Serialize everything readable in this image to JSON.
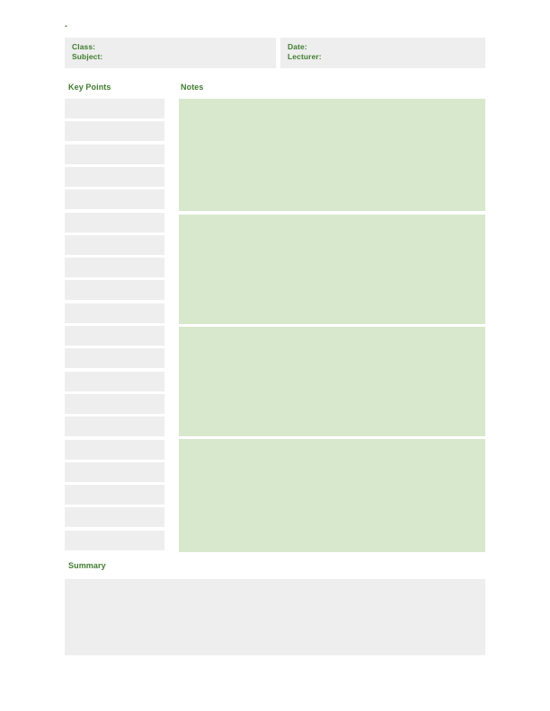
{
  "page": {
    "stray_mark": ".",
    "background_color": "#ffffff"
  },
  "colors": {
    "heading_green": "#3f7c2f",
    "field_fill_grey": "#eeeeee",
    "notes_fill_green": "#d8e8cc"
  },
  "header": {
    "left_cell": {
      "class_label": "Class:",
      "subject_label": "Subject:"
    },
    "right_cell": {
      "date_label": "Date:",
      "lecturer_label": "Lecturer:"
    }
  },
  "captions": {
    "key_points": "Key Points",
    "notes": "Notes",
    "summary": "Summary"
  },
  "key_points": {
    "row_count": 20,
    "rows": [
      {
        "value": ""
      },
      {
        "value": ""
      },
      {
        "value": ""
      },
      {
        "value": ""
      },
      {
        "value": ""
      },
      {
        "value": ""
      },
      {
        "value": ""
      },
      {
        "value": ""
      },
      {
        "value": ""
      },
      {
        "value": ""
      },
      {
        "value": ""
      },
      {
        "value": ""
      },
      {
        "value": ""
      },
      {
        "value": ""
      },
      {
        "value": ""
      },
      {
        "value": ""
      },
      {
        "value": ""
      },
      {
        "value": ""
      },
      {
        "value": ""
      },
      {
        "value": ""
      }
    ]
  },
  "notes": {
    "block_count": 4,
    "blocks": [
      {
        "value": ""
      },
      {
        "value": ""
      },
      {
        "value": ""
      },
      {
        "value": ""
      }
    ]
  },
  "summary": {
    "value": ""
  }
}
